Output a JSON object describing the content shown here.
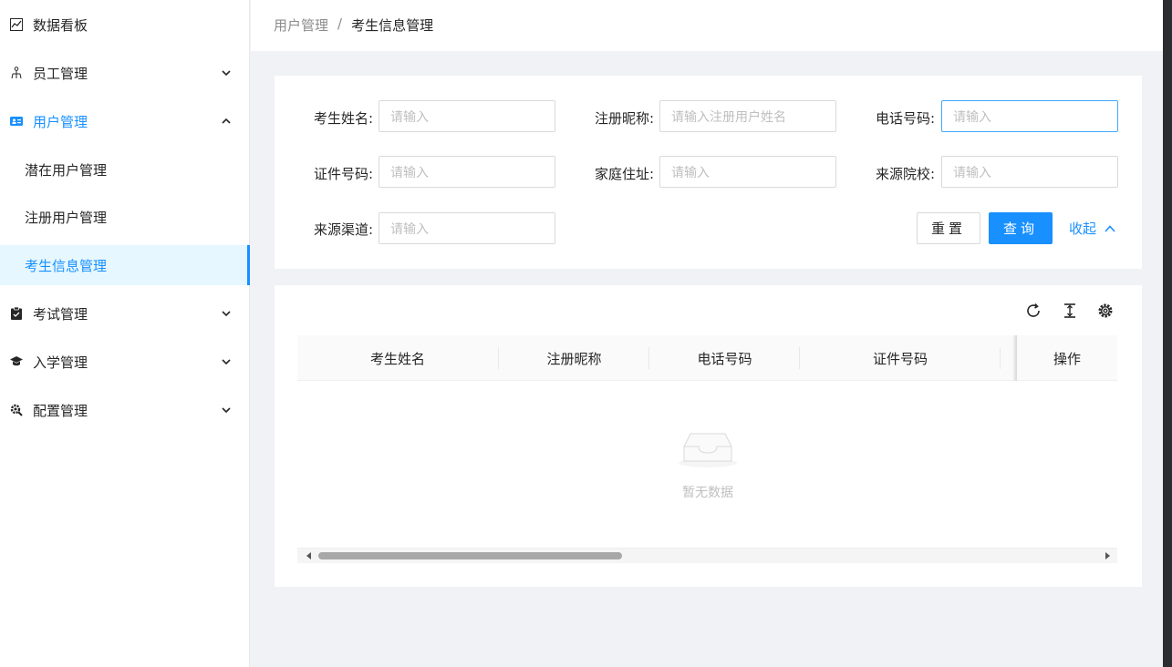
{
  "sidebar": {
    "items": [
      {
        "label": "数据看板",
        "icon": "chart-line-icon"
      },
      {
        "label": "员工管理",
        "icon": "org-chart-icon"
      },
      {
        "label": "用户管理",
        "icon": "id-card-icon"
      },
      {
        "label": "考试管理",
        "icon": "clipboard-icon"
      },
      {
        "label": "入学管理",
        "icon": "graduation-cap-icon"
      },
      {
        "label": "配置管理",
        "icon": "settings-gear-icon"
      }
    ],
    "sub_items": [
      {
        "label": "潜在用户管理"
      },
      {
        "label": "注册用户管理"
      },
      {
        "label": "考生信息管理"
      }
    ]
  },
  "breadcrumb": {
    "parent": "用户管理",
    "separator": "/",
    "current": "考生信息管理"
  },
  "search": {
    "fields": [
      {
        "label": "考生姓名:",
        "placeholder": "请输入"
      },
      {
        "label": "注册昵称:",
        "placeholder": "请输入注册用户姓名"
      },
      {
        "label": "电话号码:",
        "placeholder": "请输入"
      },
      {
        "label": "证件号码:",
        "placeholder": "请输入"
      },
      {
        "label": "家庭住址:",
        "placeholder": "请输入"
      },
      {
        "label": "来源院校:",
        "placeholder": "请输入"
      },
      {
        "label": "来源渠道:",
        "placeholder": "请输入"
      }
    ],
    "reset_label": "重置",
    "query_label": "查询",
    "collapse_label": "收起"
  },
  "table": {
    "columns": [
      "考生姓名",
      "注册昵称",
      "电话号码",
      "证件号码",
      "操作"
    ],
    "empty_text": "暂无数据"
  },
  "colors": {
    "accent": "#1890ff",
    "selected_bg": "#e6f7ff",
    "page_bg": "#f0f2f5"
  }
}
